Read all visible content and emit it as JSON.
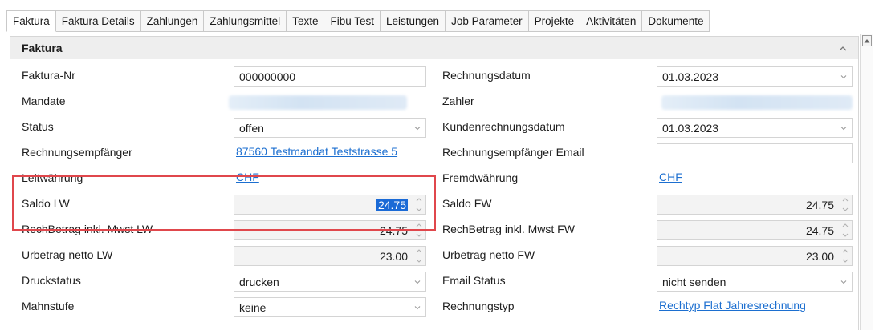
{
  "tabs": [
    {
      "label": "Faktura",
      "active": true
    },
    {
      "label": "Faktura Details",
      "active": false
    },
    {
      "label": "Zahlungen",
      "active": false
    },
    {
      "label": "Zahlungsmittel",
      "active": false
    },
    {
      "label": "Texte",
      "active": false
    },
    {
      "label": "Fibu Test",
      "active": false
    },
    {
      "label": "Leistungen",
      "active": false
    },
    {
      "label": "Job Parameter",
      "active": false
    },
    {
      "label": "Projekte",
      "active": false
    },
    {
      "label": "Aktivitäten",
      "active": false
    },
    {
      "label": "Dokumente",
      "active": false
    }
  ],
  "section": {
    "title": "Faktura"
  },
  "rows": [
    {
      "left": {
        "label": "Faktura-Nr",
        "kind": "text",
        "value": "000000000"
      },
      "right": {
        "label": "Rechnungsdatum",
        "kind": "dropdown",
        "value": "01.03.2023"
      }
    },
    {
      "left": {
        "label": "Mandate",
        "kind": "redacted"
      },
      "right": {
        "label": "Zahler",
        "kind": "redacted"
      }
    },
    {
      "left": {
        "label": "Status",
        "kind": "dropdown",
        "value": "offen"
      },
      "right": {
        "label": "Kundenrechnungsdatum",
        "kind": "dropdown",
        "value": "01.03.2023"
      }
    },
    {
      "left": {
        "label": "Rechnungsempfänger",
        "kind": "link",
        "value": "87560 Testmandat  Teststrasse 5"
      },
      "right": {
        "label": "Rechnungsempfänger Email",
        "kind": "text",
        "value": ""
      }
    },
    {
      "left": {
        "label": "Leitwährung",
        "kind": "link",
        "value": "CHF"
      },
      "right": {
        "label": "Fremdwährung",
        "kind": "link",
        "value": "CHF"
      }
    },
    {
      "left": {
        "label": "Saldo LW",
        "kind": "number",
        "value": "24.75",
        "selected": true
      },
      "right": {
        "label": "Saldo FW",
        "kind": "number",
        "value": "24.75"
      }
    },
    {
      "left": {
        "label": "RechBetrag inkl. Mwst LW",
        "kind": "number",
        "value": "24.75"
      },
      "right": {
        "label": "RechBetrag inkl. Mwst FW",
        "kind": "number",
        "value": "24.75"
      }
    },
    {
      "left": {
        "label": "Urbetrag netto LW",
        "kind": "number",
        "value": "23.00"
      },
      "right": {
        "label": "Urbetrag netto FW",
        "kind": "number",
        "value": "23.00"
      }
    },
    {
      "left": {
        "label": "Druckstatus",
        "kind": "dropdown",
        "value": "drucken"
      },
      "right": {
        "label": "Email Status",
        "kind": "dropdown",
        "value": "nicht senden"
      }
    },
    {
      "left": {
        "label": "Mahnstufe",
        "kind": "dropdown",
        "value": "keine"
      },
      "right": {
        "label": "Rechnungstyp",
        "kind": "link",
        "value": "Rechtyp Flat Jahresrechnung"
      }
    }
  ],
  "colors": {
    "highlight": "#e0474c",
    "link": "#1c6fd0",
    "selection": "#1a6ad6"
  },
  "icons": {
    "collapse": "chevron-up-icon",
    "dropdown": "chevron-down-icon",
    "spinner": "spin-arrows-icon",
    "scroll_up": "scroll-up-arrow-icon"
  }
}
